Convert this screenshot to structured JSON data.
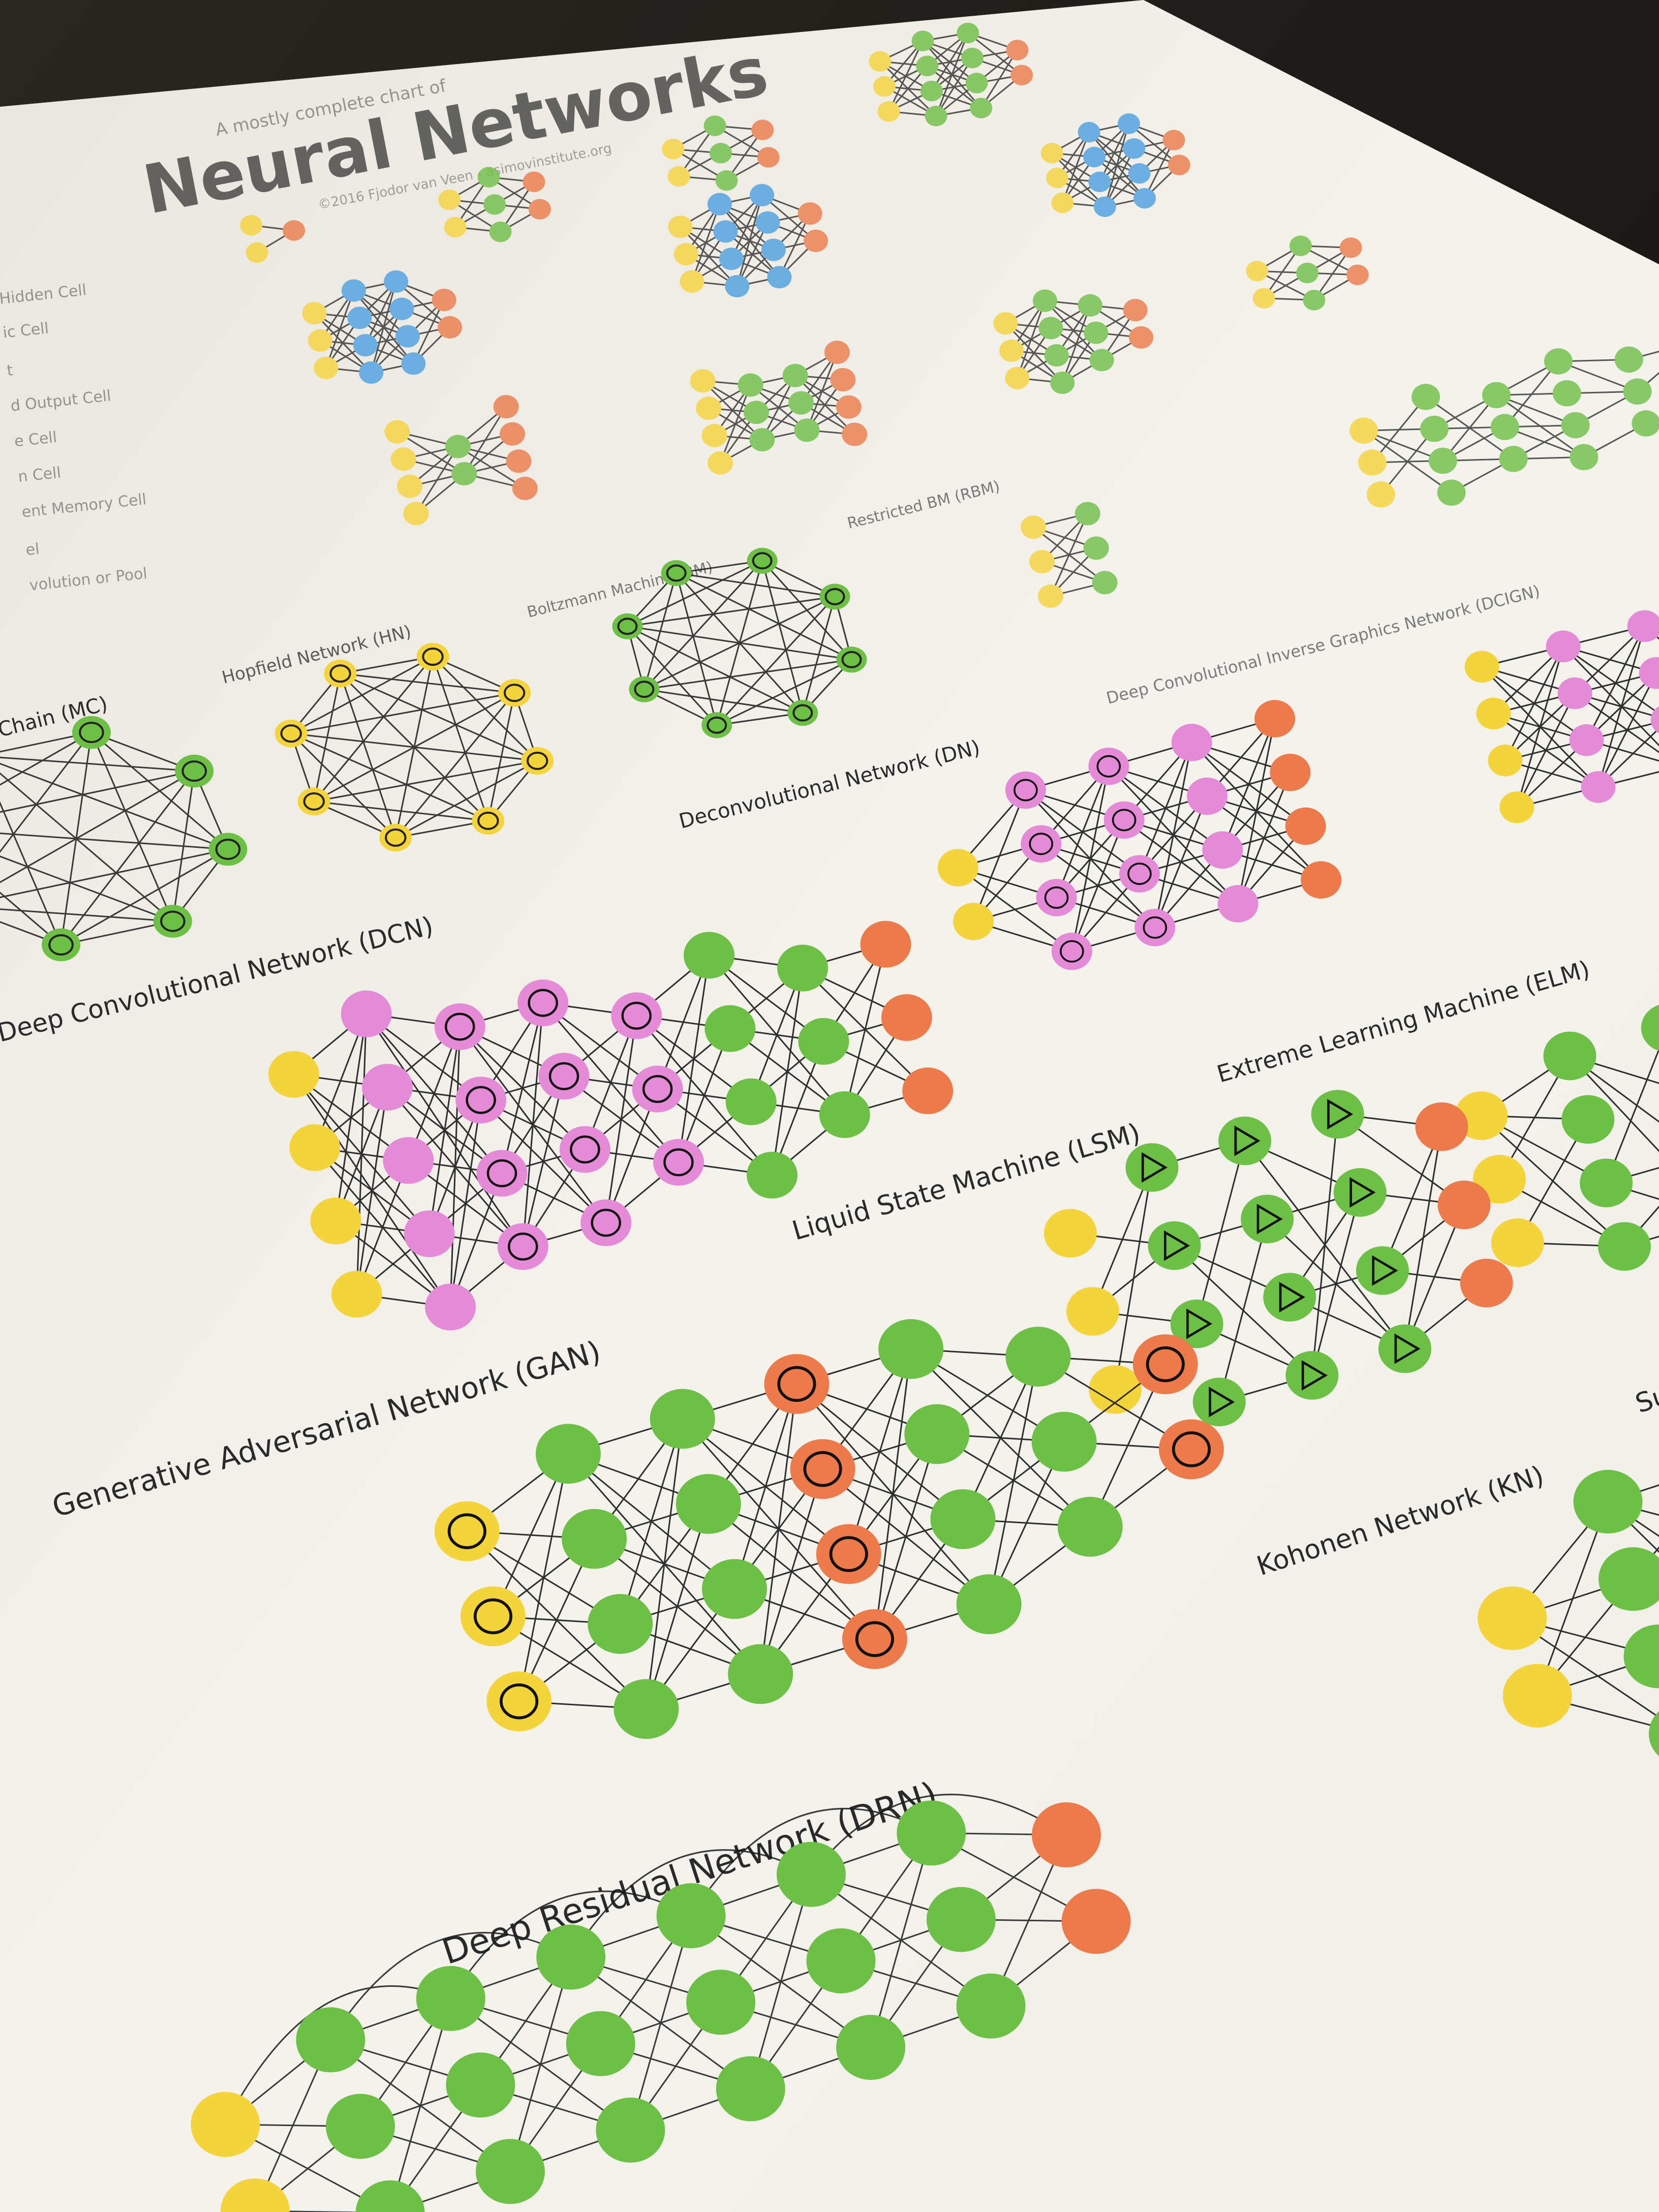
{
  "photo": {
    "subject": "poster-photo",
    "poster": {
      "small_title": "A mostly complete chart of",
      "title": "Neural Networks",
      "subtitle": "©2016 Fjodor van Veen - asimovinstitute.org"
    },
    "legend_fragments": [
      "Hidden Cell",
      "ic Cell",
      "t",
      "d Output Cell",
      "e Cell",
      "n Cell",
      "ent Memory Cell",
      "el",
      "volution or Pool"
    ],
    "labels": {
      "mc": "Chain (MC)",
      "hn": "Hopfield Network (HN)",
      "bm": "Boltzmann Machine (BM)",
      "rbm": "Restricted BM (RBM)",
      "dcign": "Deep Convolutional Inverse Graphics Network (DCIGN)",
      "dn": "Deconvolutional Network (DN)",
      "dcn": "Deep Convolutional Network (DCN)",
      "elm": "Extreme Learning Machine (ELM)",
      "lsm": "Liquid State Machine (LSM)",
      "gan": "Generative Adversarial Network (GAN)",
      "kn": "Kohonen Network (KN)",
      "svm_fragment": "Sup",
      "drn": "Deep Residual Network (DRN)"
    },
    "colors": {
      "paper": "#f4f2ec",
      "input_cell": "#f5d33a",
      "hidden_cell": "#6dbf45",
      "output_cell": "#ec7a4a",
      "memory_cell": "#4a9fe0",
      "conv_cell": "#e58ad6",
      "edge": "#1a1a1a"
    }
  }
}
